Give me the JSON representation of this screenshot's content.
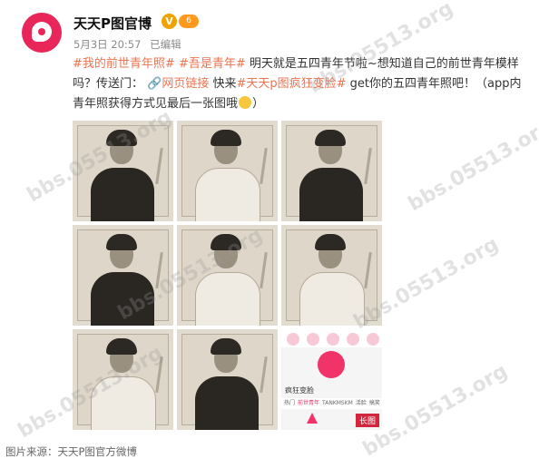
{
  "post": {
    "author": "天天P图官博",
    "verified_badge": "V",
    "vip_badge": "6",
    "date": "5月3日 20:57",
    "edited": "已编辑",
    "tag_1": "#我的前世青年照#",
    "tag_2": "#吾是青年#",
    "text_1": " 明天就是五四青年节啦~想知道自己的前世青年模样吗？传送门：",
    "link_label": "网页链接",
    "text_2": " 快来",
    "tag_3": "#天天p图疯狂变脸#",
    "text_3": " get你的五四青年照吧！（app内青年照获得方式见最后一张图哦",
    "text_4": "）"
  },
  "app_screenshot": {
    "section_title": "疯狂变脸",
    "tabs": [
      "热门",
      "前世青年",
      "TANKMSKM",
      "活脸",
      "搞笑"
    ],
    "long_image_badge": "长图"
  },
  "caption": "图片来源：天天P图官方微博",
  "watermark": "bbs.05513.org"
}
